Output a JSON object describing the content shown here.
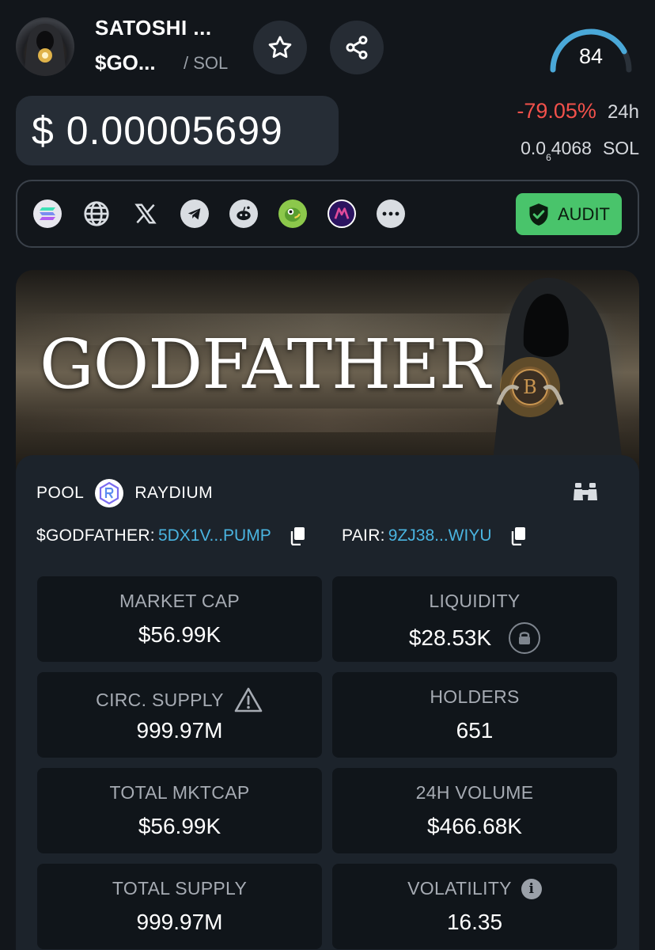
{
  "header": {
    "token_name": "SATOSHI ...",
    "token_symbol": "$GO...",
    "chain": "/ SOL",
    "score": "84",
    "score_fraction": 0.84,
    "price": "$ 0.00005699",
    "change_pct": "-79.05%",
    "change_period": "24h",
    "price_sol_prefix": "0.0",
    "price_sol_zeros": "6",
    "price_sol_digits": "4068",
    "price_sol_unit": "SOL"
  },
  "links": {
    "icons": [
      "solana-icon",
      "globe-icon",
      "x-icon",
      "telegram-icon",
      "reddit-icon",
      "coingecko-icon",
      "app-icon",
      "more-icon"
    ],
    "audit_label": "AUDIT"
  },
  "banner": {
    "title": "GODFATHER"
  },
  "pool": {
    "label": "POOL",
    "dex": "RAYDIUM",
    "token_label": "$GODFATHER:",
    "token_address": "5DX1V...PUMP",
    "pair_label": "PAIR:",
    "pair_address": "9ZJ38...WIYU"
  },
  "stats": {
    "market_cap": {
      "label": "MARKET CAP",
      "value": "$56.99K"
    },
    "liquidity": {
      "label": "LIQUIDITY",
      "value": "$28.53K"
    },
    "circ_supply": {
      "label": "CIRC. SUPPLY",
      "value": "999.97M"
    },
    "holders": {
      "label": "HOLDERS",
      "value": "651"
    },
    "total_mktcap": {
      "label": "TOTAL MKTCAP",
      "value": "$56.99K"
    },
    "volume_24h": {
      "label": "24H VOLUME",
      "value": "$466.68K"
    },
    "total_supply": {
      "label": "TOTAL SUPPLY",
      "value": "999.97M"
    },
    "volatility": {
      "label": "VOLATILITY",
      "value": "16.35"
    }
  },
  "colors": {
    "background": "#12161b",
    "negative": "#f2514b",
    "link": "#4ab4e0",
    "audit_green": "#49c46b",
    "gauge": "#4aa8d8"
  }
}
